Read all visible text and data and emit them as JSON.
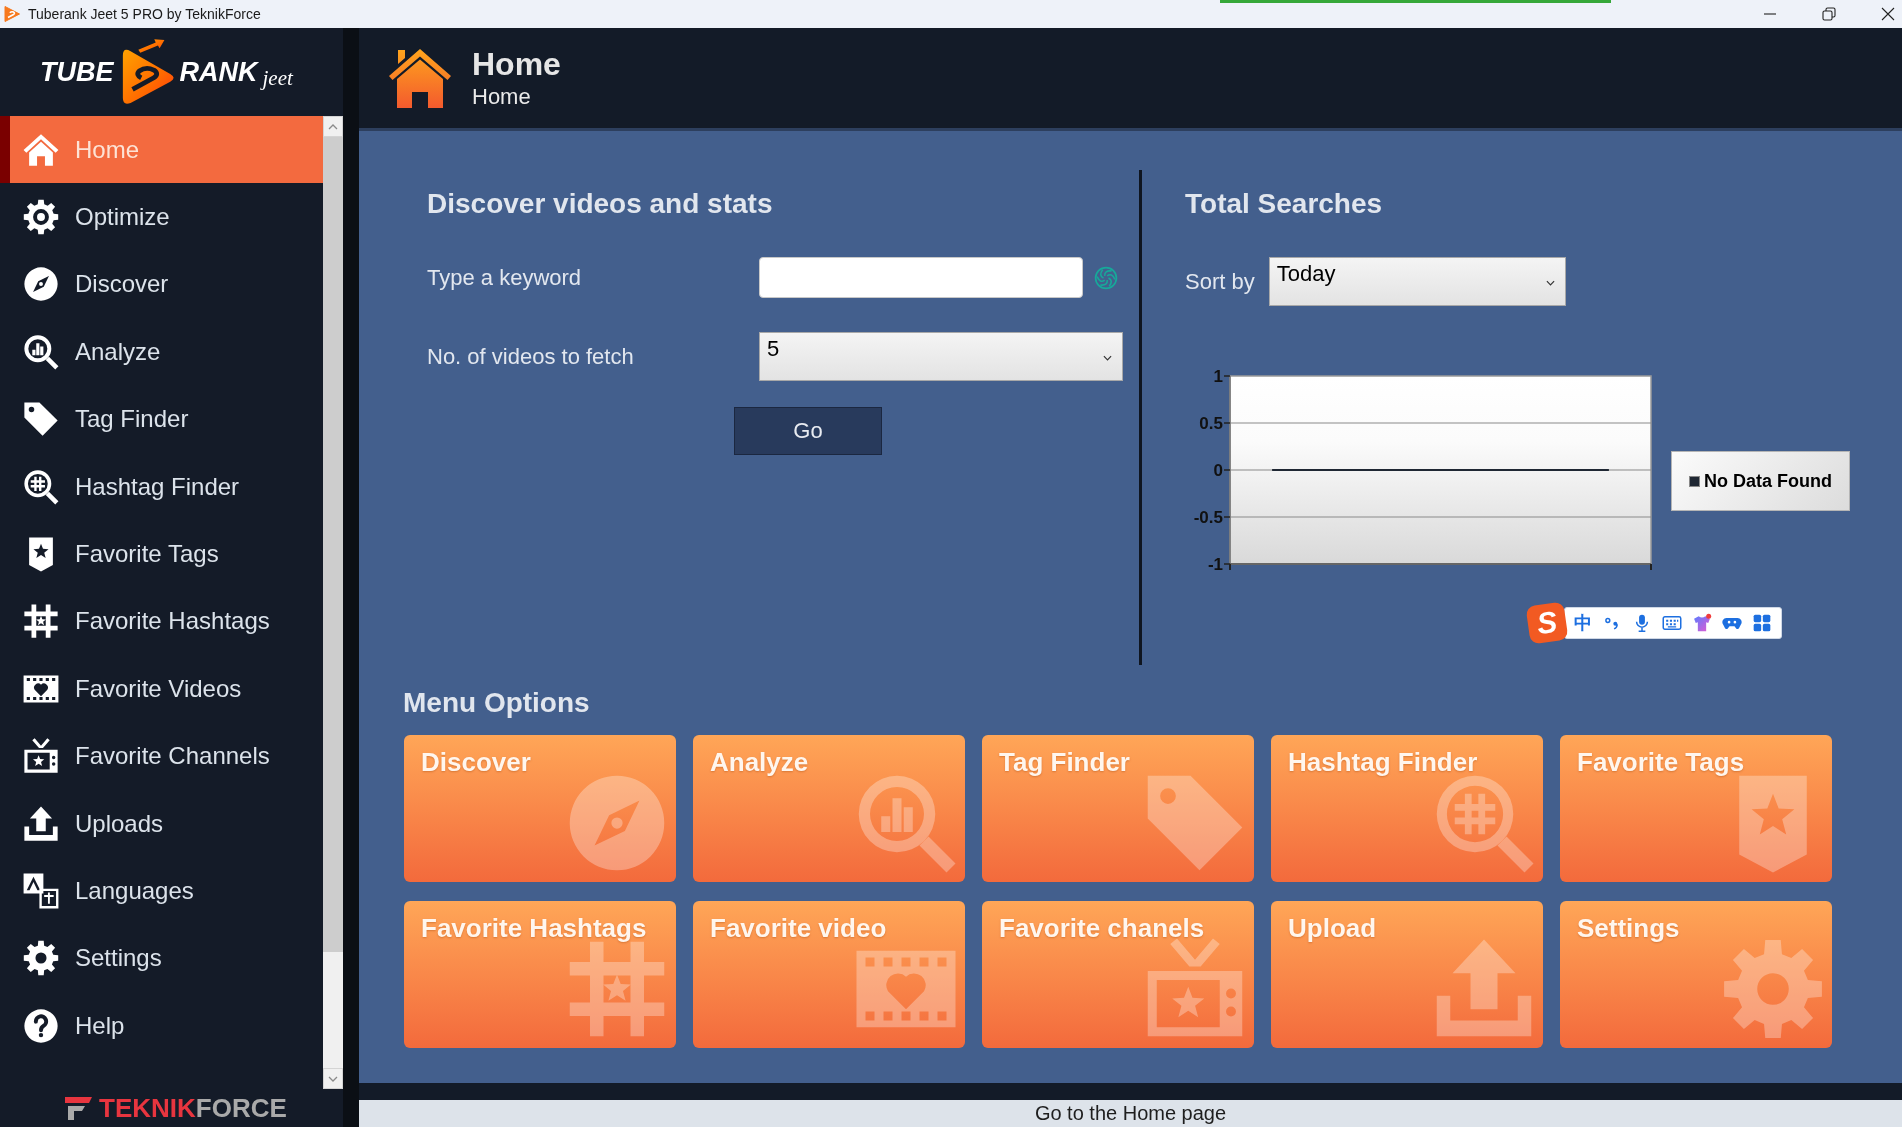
{
  "window": {
    "title": "Tuberank Jeet 5 PRO by TeknikForce"
  },
  "logo": {
    "left": "TUBE",
    "right": "RANK",
    "tagline": "jeet"
  },
  "sidebar": {
    "items": [
      {
        "label": "Home",
        "selected": true
      },
      {
        "label": "Optimize",
        "selected": false
      },
      {
        "label": "Discover",
        "selected": false
      },
      {
        "label": "Analyze",
        "selected": false
      },
      {
        "label": "Tag Finder",
        "selected": false
      },
      {
        "label": "Hashtag Finder",
        "selected": false
      },
      {
        "label": "Favorite Tags",
        "selected": false
      },
      {
        "label": "Favorite Hashtags",
        "selected": false
      },
      {
        "label": "Favorite Videos",
        "selected": false
      },
      {
        "label": "Favorite Channels",
        "selected": false
      },
      {
        "label": "Uploads",
        "selected": false
      },
      {
        "label": "Languages",
        "selected": false
      },
      {
        "label": "Settings",
        "selected": false
      },
      {
        "label": "Help",
        "selected": false
      }
    ]
  },
  "footer_logo": {
    "first": "TEKNIK",
    "second": "FORCE"
  },
  "header": {
    "title": "Home",
    "subtitle": "Home"
  },
  "discover": {
    "title": "Discover videos and stats",
    "fields": [
      {
        "kind": "text",
        "label": "Type a keyword"
      },
      {
        "kind": "select",
        "label": "No. of videos to fetch",
        "value": "5"
      }
    ],
    "button": "Go"
  },
  "total_searches": {
    "title": "Total Searches",
    "sort_label": "Sort by",
    "sort_value": "Today",
    "chart_data": {
      "type": "line",
      "categories": [
        null,
        null,
        null,
        null,
        null
      ],
      "ylim": [
        -1,
        1
      ],
      "yticks": [
        -1,
        -0.5,
        0,
        0.5,
        1
      ],
      "grid": true,
      "series": [
        {
          "name": "No Data Found",
          "color": "#1f2733",
          "values": [
            0,
            0,
            0,
            0,
            0
          ]
        }
      ]
    }
  },
  "ime_toolbar": {
    "logo": "S",
    "mode": "中"
  },
  "menu_options": {
    "title": "Menu Options",
    "tiles": [
      "Discover",
      "Analyze",
      "Tag Finder",
      "Hashtag Finder",
      "Favorite Tags",
      "Favorite Hashtags",
      "Favorite video",
      "Favorite chanels",
      "Upload",
      "Settings"
    ]
  },
  "status_bar": {
    "text": "Go to the Home page"
  }
}
